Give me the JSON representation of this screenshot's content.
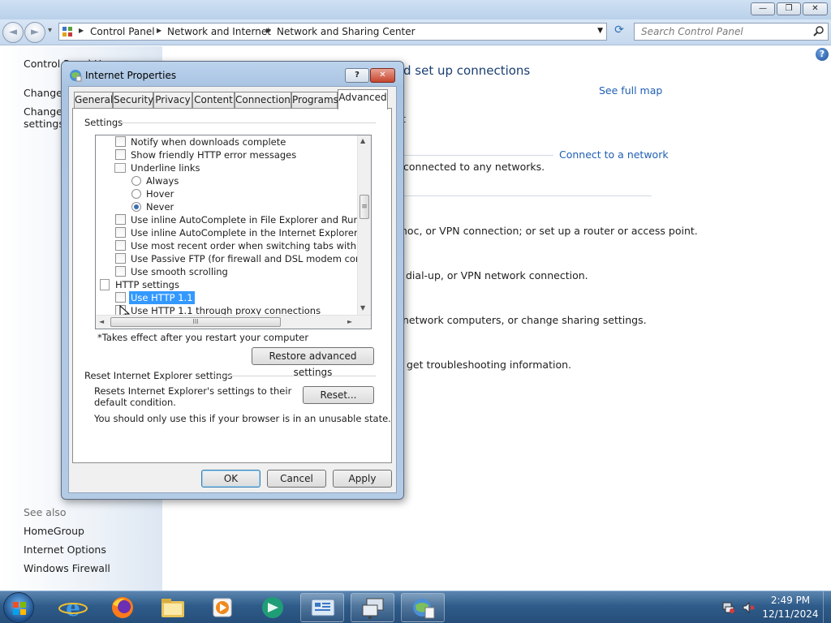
{
  "window": {
    "minimize": "—",
    "maximize": "❐",
    "close": "✕"
  },
  "address": {
    "back": "◄",
    "forward": "►",
    "history": "▾",
    "crumbs": [
      "Control Panel",
      "Network and Internet",
      "Network and Sharing Center"
    ],
    "refresh": "⟳",
    "search_placeholder": "Search Control Panel"
  },
  "sidebar": {
    "items": [
      "Control Panel Home",
      "Change adapter settings",
      "Change advanced sharing",
      "settings"
    ],
    "see_also_label": "See also",
    "see_also": [
      "HomeGroup",
      "Internet Options",
      "Windows Firewall"
    ]
  },
  "content": {
    "title": "d set up connections",
    "see_full_map": "See full map",
    "fragment_t": "t",
    "connect_to_network": "Connect to a network",
    "not_connected": "connected to any networks.",
    "setup_connection": "hoc, or VPN connection; or set up a router or access point.",
    "connect_network": "dial-up, or VPN network connection.",
    "homegroup": "network computers, or change sharing settings.",
    "troubleshoot": "get troubleshooting information."
  },
  "dialog": {
    "title": "Internet Properties",
    "help": "?",
    "close": "✕",
    "tabs": [
      "General",
      "Security",
      "Privacy",
      "Content",
      "Connections",
      "Programs",
      "Advanced"
    ],
    "active_tab": "Advanced",
    "settings_group": "Settings",
    "settings": [
      {
        "type": "checkbox",
        "label": "Notify when downloads complete",
        "checked": false
      },
      {
        "type": "checkbox",
        "label": "Show friendly HTTP error messages",
        "checked": false
      },
      {
        "type": "group",
        "label": "Underline links"
      },
      {
        "type": "radio",
        "label": "Always",
        "checked": false
      },
      {
        "type": "radio",
        "label": "Hover",
        "checked": false
      },
      {
        "type": "radio",
        "label": "Never",
        "checked": true
      },
      {
        "type": "checkbox",
        "label": "Use inline AutoComplete in File Explorer and Run Dialog",
        "checked": false
      },
      {
        "type": "checkbox",
        "label": "Use inline AutoComplete in the Internet Explorer Address",
        "checked": false
      },
      {
        "type": "checkbox",
        "label": "Use most recent order when switching tabs with Ctrl+Tab",
        "checked": false
      },
      {
        "type": "checkbox",
        "label": "Use Passive FTP (for firewall and DSL modem compatibility",
        "checked": false
      },
      {
        "type": "checkbox",
        "label": "Use smooth scrolling",
        "checked": false
      },
      {
        "type": "category",
        "label": "HTTP settings"
      },
      {
        "type": "checkbox",
        "label": "Use HTTP 1.1",
        "checked": false,
        "selected": true
      },
      {
        "type": "checkbox",
        "label": "Use HTTP 1.1 through proxy connections",
        "checked": false
      }
    ],
    "scroll": {
      "up": "▲",
      "down": "▼",
      "left": "◄",
      "right": "►",
      "grip": "≡",
      "hgrip": "III"
    },
    "restart_note": "*Takes effect after you restart your computer",
    "restore_button": "Restore advanced settings",
    "reset_group": "Reset Internet Explorer settings",
    "reset_description": "Resets Internet Explorer's settings to their default condition.",
    "reset_button": "Reset...",
    "reset_warning": "You should only use this if your browser is in an unusable state.",
    "ok_button": "OK",
    "cancel_button": "Cancel",
    "apply_button": "Apply"
  },
  "taskbar": {
    "time": "2:49 PM",
    "date": "12/11/2024"
  },
  "colors": {
    "link_blue": "#1f5fb4",
    "selection_blue": "#3399ff",
    "taskbar": "#2f5c8a"
  }
}
